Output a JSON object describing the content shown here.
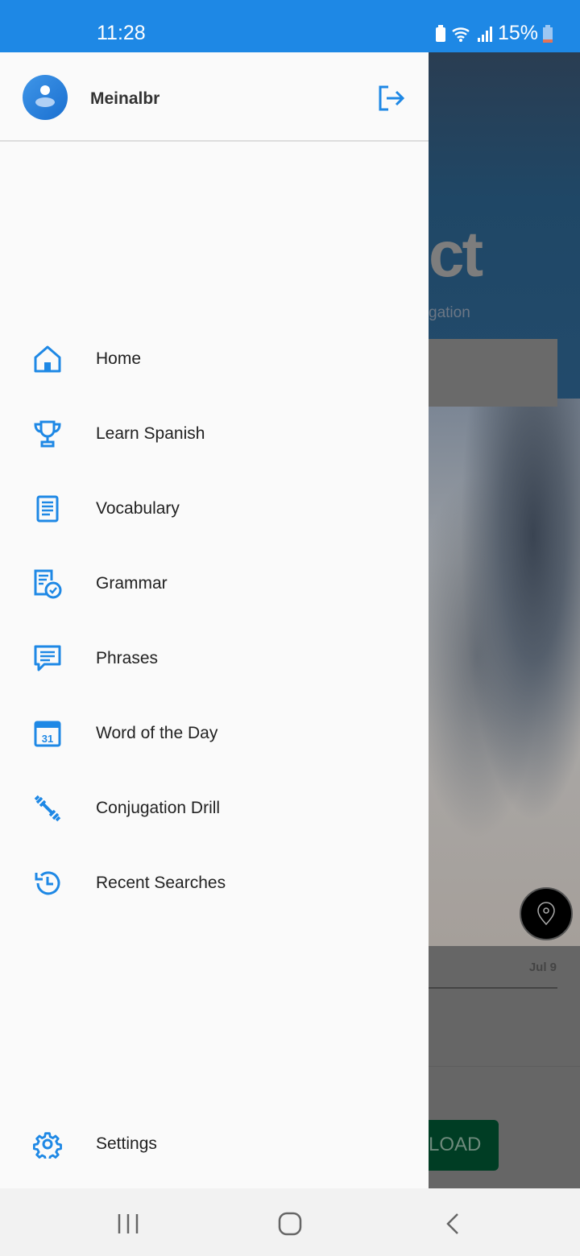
{
  "status_bar": {
    "time": "11:28",
    "battery": "15%"
  },
  "drawer": {
    "user_name": "Meinalbr",
    "items": [
      {
        "label": "Home",
        "icon": "home-icon"
      },
      {
        "label": "Learn Spanish",
        "icon": "trophy-icon"
      },
      {
        "label": "Vocabulary",
        "icon": "book-icon"
      },
      {
        "label": "Grammar",
        "icon": "grammar-check-icon"
      },
      {
        "label": "Phrases",
        "icon": "chat-icon"
      },
      {
        "label": "Word of the Day",
        "icon": "calendar-icon",
        "calendar_day": "31"
      },
      {
        "label": "Conjugation Drill",
        "icon": "dumbbell-icon"
      },
      {
        "label": "Recent Searches",
        "icon": "history-icon"
      }
    ],
    "settings_label": "Settings"
  },
  "background": {
    "title_fragment": "ct",
    "subtitle_fragment": "gation",
    "date": "Jul 9",
    "button_fragment": "LOAD"
  },
  "colors": {
    "accent": "#1e88e5",
    "download_button": "#003d24"
  }
}
